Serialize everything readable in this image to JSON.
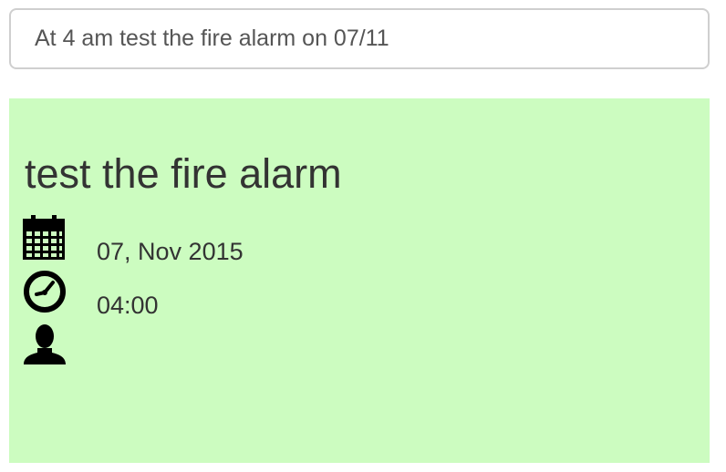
{
  "input": {
    "value": "At 4 am test the fire alarm on 07/11"
  },
  "event": {
    "title": "test the fire alarm",
    "date": "07, Nov 2015",
    "time": "04:00",
    "person": ""
  },
  "icons": {
    "date": "calendar-icon",
    "time": "clock-icon",
    "person": "user-icon"
  },
  "colors": {
    "card_background": "#ccfcc0",
    "input_border": "#cfcfcf",
    "text": "#333333"
  }
}
